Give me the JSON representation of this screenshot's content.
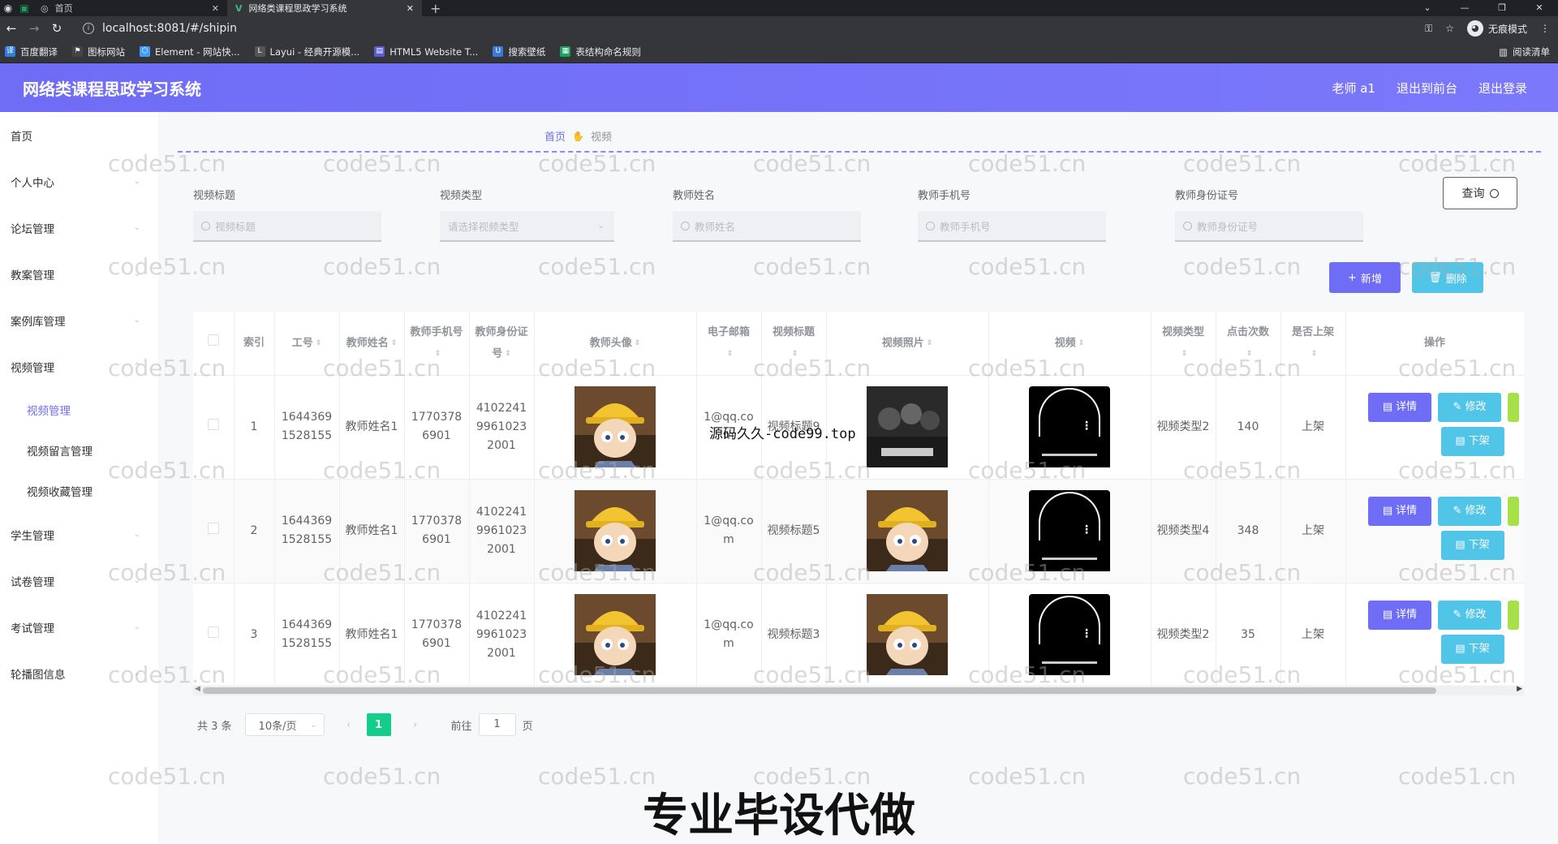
{
  "browser": {
    "tabs": [
      {
        "title": "首页"
      },
      {
        "title": "网络类课程思政学习系统"
      }
    ],
    "url": "localhost:8081/#/shipin",
    "incognito_label": "无痕模式",
    "bookmarks": [
      {
        "label": "百度翻译",
        "color": "#2f7de1"
      },
      {
        "label": "图标网站",
        "color": "#444444"
      },
      {
        "label": "Element - 网站快...",
        "color": "#409eff"
      },
      {
        "label": "Layui - 经典开源模...",
        "color": "#555555"
      },
      {
        "label": "HTML5 Website T...",
        "color": "#5b5bd6"
      },
      {
        "label": "搜索壁纸",
        "color": "#3a7bd5"
      },
      {
        "label": "表结构命名规则",
        "color": "#1aa260"
      }
    ],
    "reading_list": "阅读清单"
  },
  "app": {
    "title": "网络类课程思政学习系统",
    "user": "老师 a1",
    "back_to_front": "退出到前台",
    "logout": "退出登录"
  },
  "sidebar": {
    "items": [
      {
        "label": "首页"
      },
      {
        "label": "个人中心"
      },
      {
        "label": "论坛管理"
      },
      {
        "label": "教案管理"
      },
      {
        "label": "案例库管理"
      },
      {
        "label": "视频管理"
      },
      {
        "label": "学生管理"
      },
      {
        "label": "试卷管理"
      },
      {
        "label": "考试管理"
      },
      {
        "label": "轮播图信息"
      }
    ],
    "sub_items": [
      {
        "label": "视频管理"
      },
      {
        "label": "视频留言管理"
      },
      {
        "label": "视频收藏管理"
      }
    ]
  },
  "breadcrumb": {
    "home": "首页",
    "current": "视频"
  },
  "search": {
    "fields": [
      {
        "label": "视频标题",
        "placeholder": "视频标题"
      },
      {
        "label": "视频类型",
        "placeholder": "请选择视频类型"
      },
      {
        "label": "教师姓名",
        "placeholder": "教师姓名"
      },
      {
        "label": "教师手机号",
        "placeholder": "教师手机号"
      },
      {
        "label": "教师身份证号",
        "placeholder": "教师身份证号"
      }
    ],
    "query_label": "查询"
  },
  "actions": {
    "add_label": "新增",
    "delete_label": "删除"
  },
  "table": {
    "headers": {
      "index": "索引",
      "work_no": "工号",
      "teacher_name": "教师姓名",
      "teacher_phone": "教师手机号",
      "teacher_id": "教师身份证号",
      "teacher_avatar": "教师头像",
      "email": "电子邮箱",
      "video_title": "视频标题",
      "video_photo": "视频照片",
      "video": "视频",
      "video_type": "视频类型",
      "clicks": "点击次数",
      "on_shelf": "是否上架",
      "operation": "操作"
    },
    "rows": [
      {
        "index": "1",
        "work_no": "16443691528155",
        "teacher_name": "教师姓名1",
        "teacher_phone": "17703786901",
        "teacher_id": "410224199610232001",
        "email": "1@qq.com",
        "video_title": "视频标题9",
        "video_type": "视频类型2",
        "clicks": "140",
        "on_shelf": "上架"
      },
      {
        "index": "2",
        "work_no": "16443691528155",
        "teacher_name": "教师姓名1",
        "teacher_phone": "17703786901",
        "teacher_id": "410224199610232001",
        "email": "1@qq.com",
        "video_title": "视频标题5",
        "video_type": "视频类型4",
        "clicks": "348",
        "on_shelf": "上架"
      },
      {
        "index": "3",
        "work_no": "16443691528155",
        "teacher_name": "教师姓名1",
        "teacher_phone": "17703786901",
        "teacher_id": "410224199610232001",
        "email": "1@qq.com",
        "video_title": "视频标题3",
        "video_type": "视频类型2",
        "clicks": "35",
        "on_shelf": "上架"
      }
    ],
    "op_detail": "详情",
    "op_edit": "修改",
    "op_down": "下架"
  },
  "pagination": {
    "total": "共 3 条",
    "page_size": "10条/页",
    "current": "1",
    "goto_prefix": "前往",
    "goto_value": "1",
    "goto_suffix": "页"
  },
  "watermark": "code51.cn",
  "overlay_text": "源码久久-code99.top",
  "banner": "专业毕设代做",
  "colors": {
    "primary": "#6f6cf6",
    "cyan": "#50c5e8",
    "green_page": "#13ce8a"
  }
}
